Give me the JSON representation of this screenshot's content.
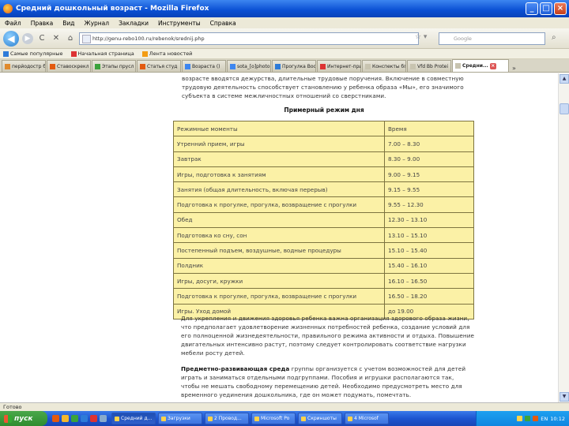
{
  "window": {
    "title": "Средний дошкольный возраст - Mozilla Firefox",
    "buttons": {
      "minimize": "_",
      "maximize": "□",
      "close": "×"
    }
  },
  "menu": [
    "Файл",
    "Правка",
    "Вид",
    "Журнал",
    "Закладки",
    "Инструменты",
    "Справка"
  ],
  "nav": {
    "back": "◀",
    "forward": "▶",
    "reload": "C",
    "stop": "✕",
    "home": "⌂",
    "url": "http://genu-rebo100.ru/rebenok/srednij.php",
    "search_placeholder": "Google"
  },
  "bookmarks": [
    {
      "label": "Самые популярные",
      "color": "#2d7bd8"
    },
    {
      "label": "Начальная страница",
      "color": "#d33"
    },
    {
      "label": "Лента новостей",
      "color": "#f39c12"
    }
  ],
  "tabs": [
    {
      "label": "перйодостр бп",
      "color": "#e08a2c",
      "active": false
    },
    {
      "label": "Ставоскрекл",
      "color": "#e35a10",
      "active": false
    },
    {
      "label": "Этапы прусл",
      "color": "#3ba33b",
      "active": false
    },
    {
      "label": "Статья студ",
      "color": "#e35a10",
      "active": false
    },
    {
      "label": "Возраста ()",
      "color": "#3d86f0",
      "active": false
    },
    {
      "label": "sota_[o]photo",
      "color": "#3d86f0",
      "active": false
    },
    {
      "label": "Прогулка Вос",
      "color": "#2d7bd8",
      "active": false
    },
    {
      "label": "Интернет-при",
      "color": "#d33",
      "active": false
    },
    {
      "label": "Конспекты бп",
      "color": "#c8c4b0",
      "active": false
    },
    {
      "label": "Vfd Bb Protei",
      "color": "#c8c4b0",
      "active": false
    },
    {
      "label": "Средни...",
      "color": "#c8c4b0",
      "active": true
    }
  ],
  "page": {
    "intro": "возрасте вводятся дежурства, длительные трудовые поручения. Включение в совместную трудовую деятельность способствует становлению у ребенка образа «Мы», его значимого субъекта в системе межличностных отношений со сверстниками.",
    "caption": "Примерный режим дня",
    "schedule": [
      {
        "activity": "Режимные моменты",
        "time": "Время"
      },
      {
        "activity": "Утренний прием, игры",
        "time": "7.00 – 8.30"
      },
      {
        "activity": "Завтрак",
        "time": "8.30 – 9.00"
      },
      {
        "activity": "Игры, подготовка к занятиям",
        "time": "9.00 – 9.15"
      },
      {
        "activity": "Занятия (общая длительность, включая перерыв)",
        "time": "9.15 – 9.55"
      },
      {
        "activity": "Подготовка к прогулке, прогулка, возвращение с прогулки",
        "time": "9.55 – 12.30"
      },
      {
        "activity": "Обед",
        "time": "12.30 – 13.10"
      },
      {
        "activity": "Подготовка ко сну, сон",
        "time": "13.10 – 15.10"
      },
      {
        "activity": "Постепенный подъем, воздушные, водные процедуры",
        "time": "15.10 – 15.40"
      },
      {
        "activity": "Полдник",
        "time": "15.40 – 16.10"
      },
      {
        "activity": "Игры, досуги, кружки",
        "time": "16.10 – 16.50"
      },
      {
        "activity": "Подготовка к прогулке, прогулка, возвращение с прогулки",
        "time": "16.50 – 18.20"
      },
      {
        "activity": "Игры. Уход домой",
        "time": "до 19.00"
      }
    ],
    "para1": "Для укрепления и движения здоровья ребенка важна организация здорового образа жизни, что предполагает удовлетворение жизненных потребностей ребенка, создание условий для его полноценной жизнедеятельности, правильного режима активности и отдыха. Повышение двигательных интенсивно растут, поэтому следует контролировать соответствие нагрузки мебели росту детей.",
    "para2_bold": "Предметно-развивающая среда",
    "para2_rest": " группы организуется с учетом возможностей для детей играть и заниматься отдельными подгруппами. Пособия и игрушки располагаются так, чтобы не мешать свободному перемещению детей. Необходимо предусмотреть место для временного уединения дошкольника, где он может подумать, помечтать."
  },
  "status": "Готово",
  "taskbar": {
    "start": "пуск",
    "quicklaunch_colors": [
      "#e35a10",
      "#f5b82e",
      "#3ba33b",
      "#2d7bd8",
      "#d33",
      "#8ac"
    ],
    "tasks": [
      {
        "label": "Средний д...",
        "active": true
      },
      {
        "label": "Загрузки",
        "active": false
      },
      {
        "label": "2 Провод...",
        "active": false
      },
      {
        "label": "Microsoft Po",
        "active": false
      },
      {
        "label": "Скриншоты",
        "active": false
      },
      {
        "label": "4 Microsof",
        "active": false
      }
    ],
    "tray_lang": "EN",
    "clock": "10:12"
  }
}
